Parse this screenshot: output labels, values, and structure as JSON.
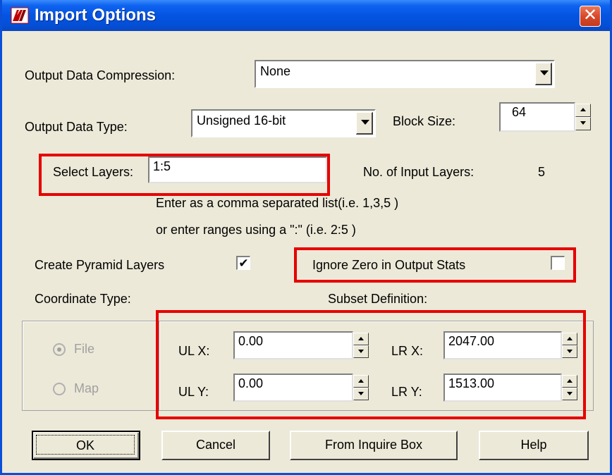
{
  "window": {
    "title": "Import Options",
    "close_glyph": "✕",
    "app_icon": "erdas-logo-icon"
  },
  "output_compression": {
    "label": "Output Data Compression:",
    "value": "None"
  },
  "output_type": {
    "label": "Output Data Type:",
    "value": "Unsigned 16-bit"
  },
  "block_size": {
    "label": "Block Size:",
    "value": "64"
  },
  "select_layers": {
    "label": "Select Layers:",
    "value": "1:5"
  },
  "input_layers": {
    "label": "No. of Input Layers:",
    "value": "5"
  },
  "hint": {
    "line1": "Enter as a comma separated list(i.e. 1,3,5 )",
    "line2": "or enter ranges using a \":\" (i.e. 2:5 )"
  },
  "pyramid": {
    "label": "Create Pyramid Layers",
    "checked": true,
    "mark": "✔"
  },
  "ignore_zero": {
    "label": "Ignore Zero in Output Stats",
    "checked": false
  },
  "coordinate_type": {
    "label": "Coordinate Type:",
    "options": [
      {
        "label": "File",
        "selected": true
      },
      {
        "label": "Map",
        "selected": false
      }
    ]
  },
  "subset": {
    "label": "Subset Definition:",
    "ul_x": {
      "label": "UL X:",
      "value": "0.00"
    },
    "ul_y": {
      "label": "UL Y:",
      "value": "0.00"
    },
    "lr_x": {
      "label": "LR X:",
      "value": "2047.00"
    },
    "lr_y": {
      "label": "LR Y:",
      "value": "1513.00"
    }
  },
  "buttons": {
    "ok": "OK",
    "cancel": "Cancel",
    "inquire": "From Inquire Box",
    "help": "Help"
  },
  "colors": {
    "title_bar": "#0454e1",
    "dialog_bg": "#ece9d8",
    "highlight": "#e60000"
  }
}
